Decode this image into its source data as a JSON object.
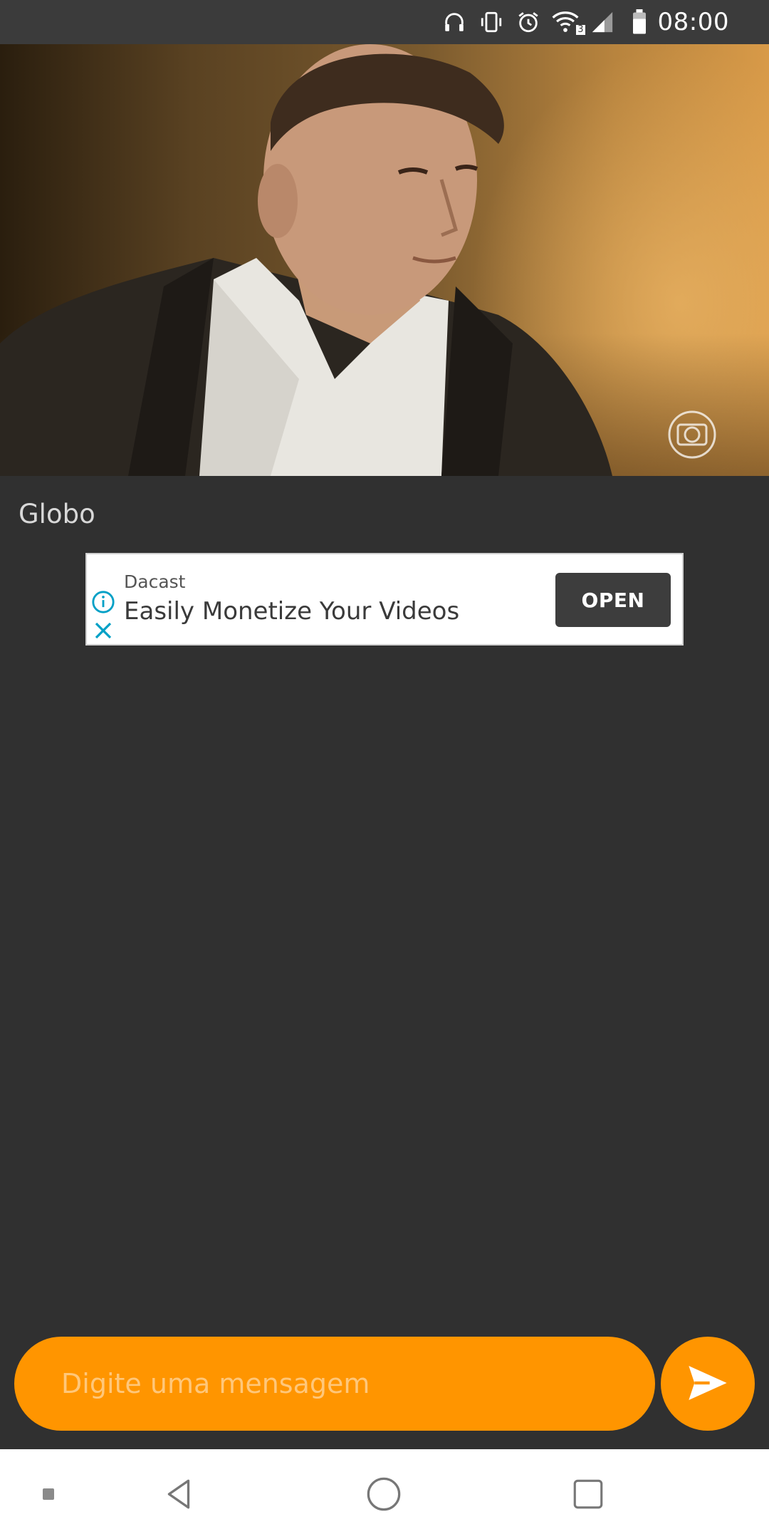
{
  "status_bar": {
    "time": "08:00",
    "icons": [
      "headphones-icon",
      "vibrate-icon",
      "alarm-icon",
      "wifi-icon",
      "signal-icon",
      "battery-icon"
    ],
    "network_badge": "3"
  },
  "video": {
    "watermark": "globo-logo-icon"
  },
  "channel": {
    "title": "Globo"
  },
  "ad": {
    "advertiser": "Dacast",
    "headline": "Easily Monetize Your Videos",
    "cta_label": "OPEN",
    "info_icon": "info-icon",
    "close_icon": "close-icon",
    "accent_color": "#00a0c6"
  },
  "composer": {
    "placeholder": "Digite uma mensagem",
    "send_icon": "send-icon",
    "accent_color": "#ff9500"
  },
  "navigation": {
    "items": [
      "menu-dot-icon",
      "back-icon",
      "home-icon",
      "recents-icon"
    ]
  }
}
